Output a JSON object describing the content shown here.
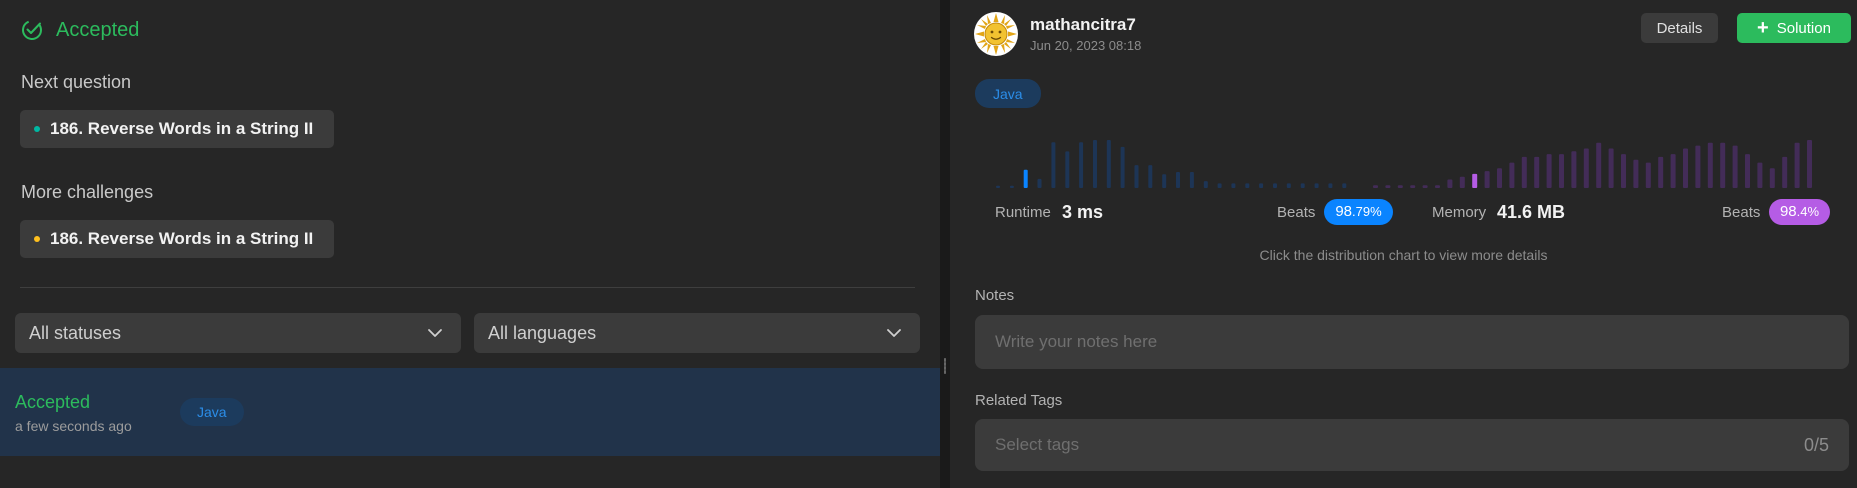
{
  "left": {
    "status_title": "Accepted",
    "next_question_label": "Next question",
    "next_question": "186. Reverse Words in a String II",
    "more_challenges_label": "More challenges",
    "more_challenge": "186. Reverse Words in a String II",
    "filter_status": "All statuses",
    "filter_language": "All languages",
    "submission": {
      "status": "Accepted",
      "time": "a few seconds ago",
      "language": "Java"
    }
  },
  "right": {
    "username": "mathancitra7",
    "date": "Jun 20, 2023 08:18",
    "details_button": "Details",
    "solution_button": "Solution",
    "language": "Java",
    "runtime": {
      "label": "Runtime",
      "value": "3 ms",
      "beats_label": "Beats",
      "beats_main": "98",
      "beats_frac": ".79%"
    },
    "memory": {
      "label": "Memory",
      "value": "41.6 MB",
      "beats_label": "Beats",
      "beats_main": "98",
      "beats_frac": ".4%"
    },
    "hint": "Click the distribution chart to view more details",
    "notes_label": "Notes",
    "notes_placeholder": "Write your notes here",
    "tags_label": "Related Tags",
    "tags_placeholder": "Select tags",
    "tags_count": "0/5"
  },
  "colors": {
    "accepted": "#2cbb5d",
    "runtime_accent": "#0a84ff",
    "memory_accent": "#b55ce5",
    "next_dot": "#00b8a3",
    "challenge_dot": "#ffc01e"
  },
  "chart_data": [
    {
      "type": "bar",
      "name": "runtime-distribution",
      "values": [
        1,
        1,
        8,
        4,
        20,
        16,
        20,
        21,
        21,
        18,
        10,
        10,
        6,
        7,
        7,
        3,
        2,
        2,
        2,
        2,
        2,
        2,
        2,
        2,
        2,
        2
      ],
      "highlight_index": 2
    },
    {
      "type": "bar",
      "name": "memory-distribution",
      "values": [
        1,
        1,
        1,
        1,
        1,
        1,
        3,
        4,
        5,
        6,
        7,
        9,
        11,
        11,
        12,
        12,
        13,
        14,
        16,
        14,
        12,
        10,
        9,
        11,
        12,
        14,
        15,
        16,
        16,
        15,
        12,
        9,
        7,
        11,
        16,
        17
      ],
      "highlight_index": 8
    }
  ]
}
